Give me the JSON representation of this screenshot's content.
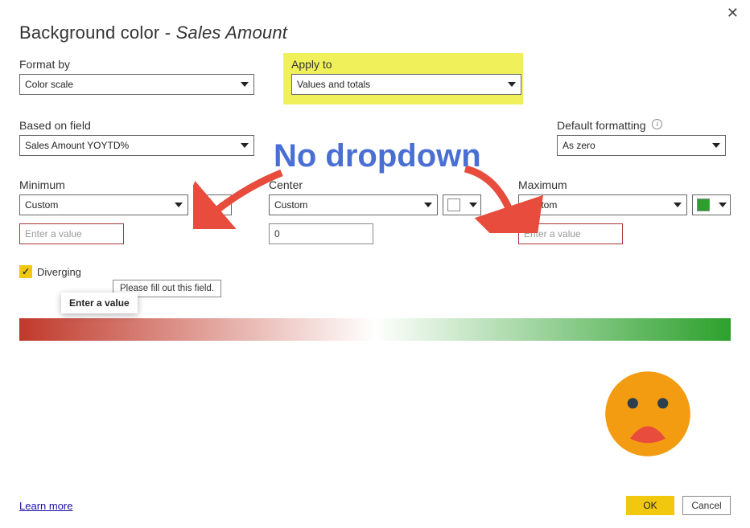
{
  "dialog": {
    "title_prefix": "Background color - ",
    "title_field": "Sales Amount",
    "close_glyph": "✕"
  },
  "format_by": {
    "label": "Format by",
    "value": "Color scale"
  },
  "apply_to": {
    "label": "Apply to",
    "value": "Values and totals"
  },
  "based_on": {
    "label": "Based on field",
    "value": "Sales Amount YOYTD%"
  },
  "default_fmt": {
    "label": "Default formatting",
    "value": "As zero",
    "info": "i"
  },
  "minimum": {
    "label": "Minimum",
    "mode": "Custom",
    "placeholder": "Enter a value",
    "swatch": "#a93636"
  },
  "center": {
    "label": "Center",
    "mode": "Custom",
    "value": "0",
    "swatch": "#ffffff"
  },
  "maximum": {
    "label": "Maximum",
    "mode": "Custom",
    "placeholder": "Enter a value",
    "swatch": "#2ca02c"
  },
  "validation_tip": "Please fill out this field.",
  "hover_tip": "Enter a value",
  "diverging": {
    "label": "Diverging",
    "checked": true,
    "checkmark": "✓"
  },
  "footer": {
    "learn": "Learn more",
    "ok": "OK",
    "cancel": "Cancel"
  },
  "annotation": {
    "text": "No dropdown"
  }
}
